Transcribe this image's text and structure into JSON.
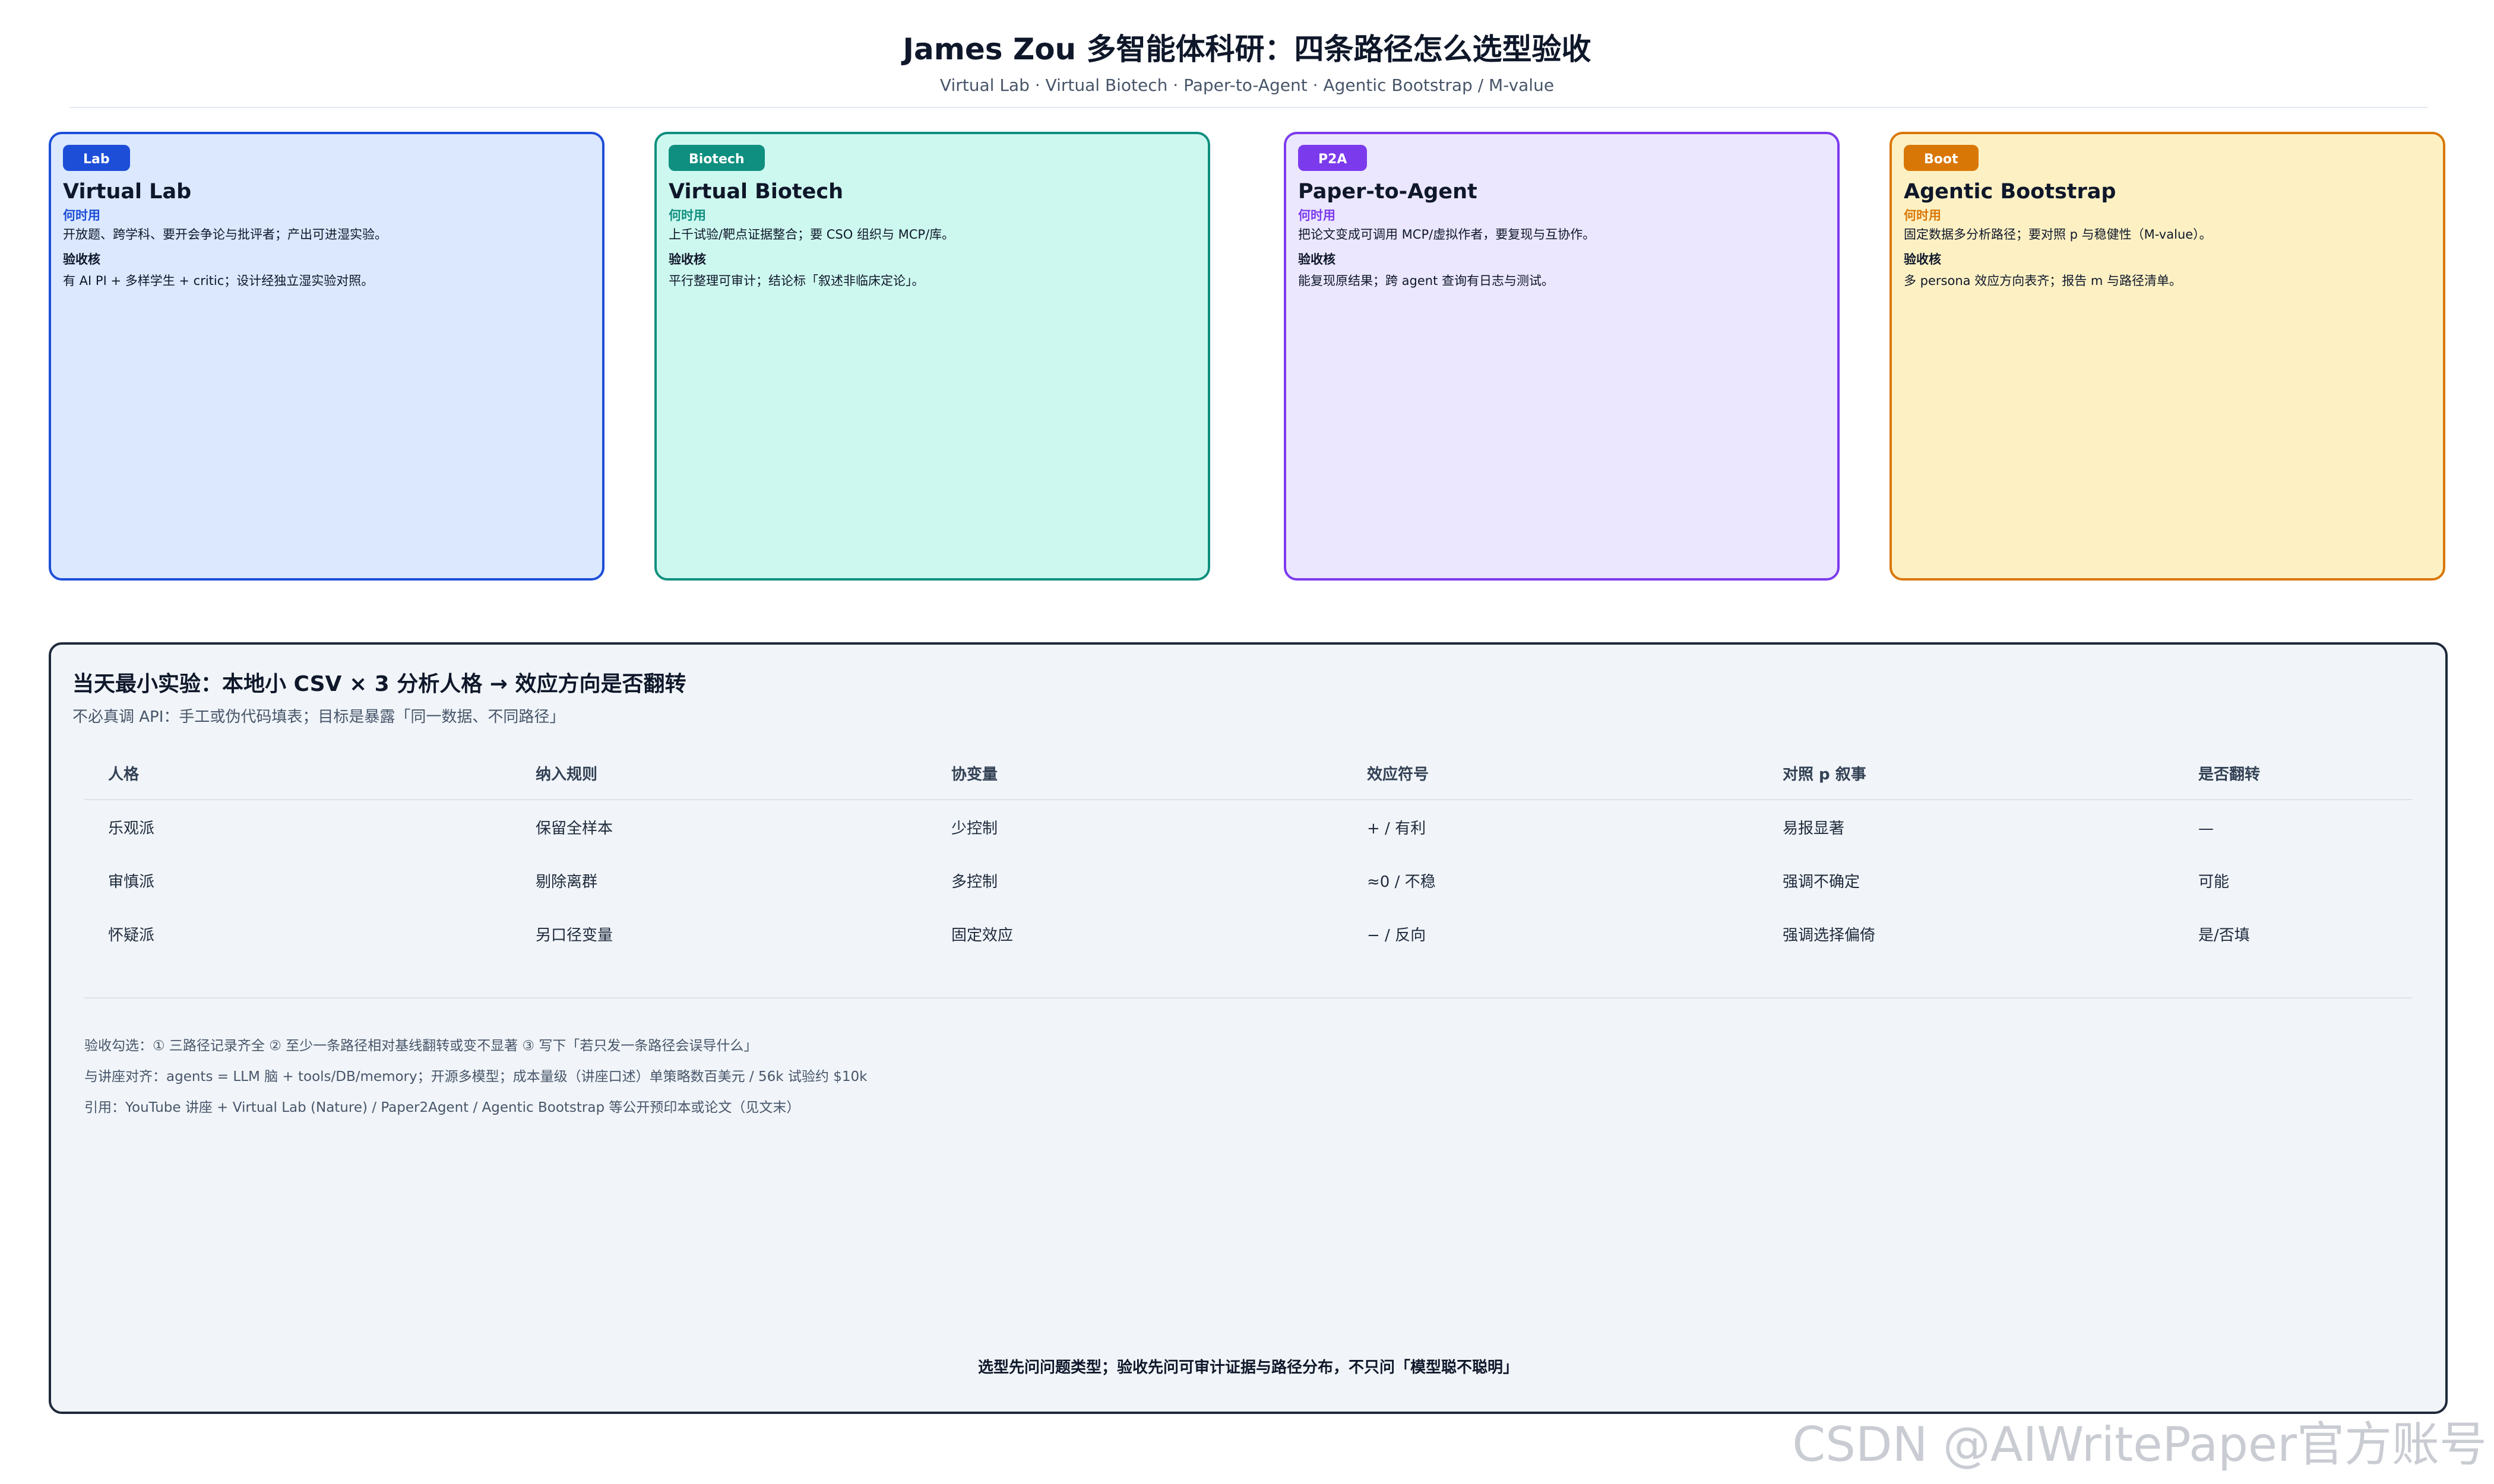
{
  "header": {
    "title": "James Zou 多智能体科研：四条路径怎么选型验收",
    "subtitle": "Virtual Lab · Virtual Biotech · Paper-to-Agent · Agentic Bootstrap / M-value"
  },
  "cards": [
    {
      "badge": "Lab",
      "title": "Virtual Lab",
      "when_label": "何时用",
      "when_text": "开放题、跨学科、要开会争论与批评者；产出可进湿实验。",
      "check_label": "验收核",
      "check_text": "有 AI PI + 多样学生 + critic；设计经独立湿实验对照。",
      "accent": "#1d4ed8"
    },
    {
      "badge": "Biotech",
      "title": "Virtual Biotech",
      "when_label": "何时用",
      "when_text": "上千试验/靶点证据整合；要 CSO 组织与 MCP/库。",
      "check_label": "验收核",
      "check_text": "平行整理可审计；结论标「叙述非临床定论」。",
      "accent": "#0f8f7f"
    },
    {
      "badge": "P2A",
      "title": "Paper-to-Agent",
      "when_label": "何时用",
      "when_text": "把论文变成可调用 MCP/虚拟作者，要复现与互协作。",
      "check_label": "验收核",
      "check_text": "能复现原结果；跨 agent 查询有日志与测试。",
      "accent": "#7c3aed"
    },
    {
      "badge": "Boot",
      "title": "Agentic Bootstrap",
      "when_label": "何时用",
      "when_text": "固定数据多分析路径；要对照 p 与稳健性（M-value）。",
      "check_label": "验收核",
      "check_text": "多 persona 效应方向表齐；报告 m 与路径清单。",
      "accent": "#d97706"
    }
  ],
  "panel": {
    "title": "当天最小实验：本地小 CSV × 3 分析人格 → 效应方向是否翻转",
    "subtitle": "不必真调 API：手工或伪代码填表；目标是暴露「同一数据、不同路径」",
    "headers": [
      "人格",
      "纳入规则",
      "协变量",
      "效应符号",
      "对照 p 叙事",
      "是否翻转"
    ],
    "rows": [
      [
        "乐观派",
        "保留全样本",
        "少控制",
        "+ / 有利",
        "易报显著",
        "—"
      ],
      [
        "审慎派",
        "剔除离群",
        "多控制",
        "≈0 / 不稳",
        "强调不确定",
        "可能"
      ],
      [
        "怀疑派",
        "另口径变量",
        "固定效应",
        "− / 反向",
        "强调选择偏倚",
        "是/否填"
      ]
    ],
    "notes": [
      "验收勾选：① 三路径记录齐全 ② 至少一条路径相对基线翻转或变不显著 ③ 写下「若只发一条路径会误导什么」",
      "与讲座对齐：agents = LLM 脑 + tools/DB/memory；开源多模型；成本量级（讲座口述）单策略数百美元 / 56k 试验约 $10k",
      "引用：YouTube 讲座 + Virtual Lab (Nature) / Paper2Agent / Agentic Bootstrap 等公开预印本或论文（见文末）"
    ],
    "footer": "选型先问问题类型；验收先问可审计证据与路径分布，不只问「模型聪不聪明」"
  },
  "watermark": "CSDN @AIWritePaper官方账号"
}
